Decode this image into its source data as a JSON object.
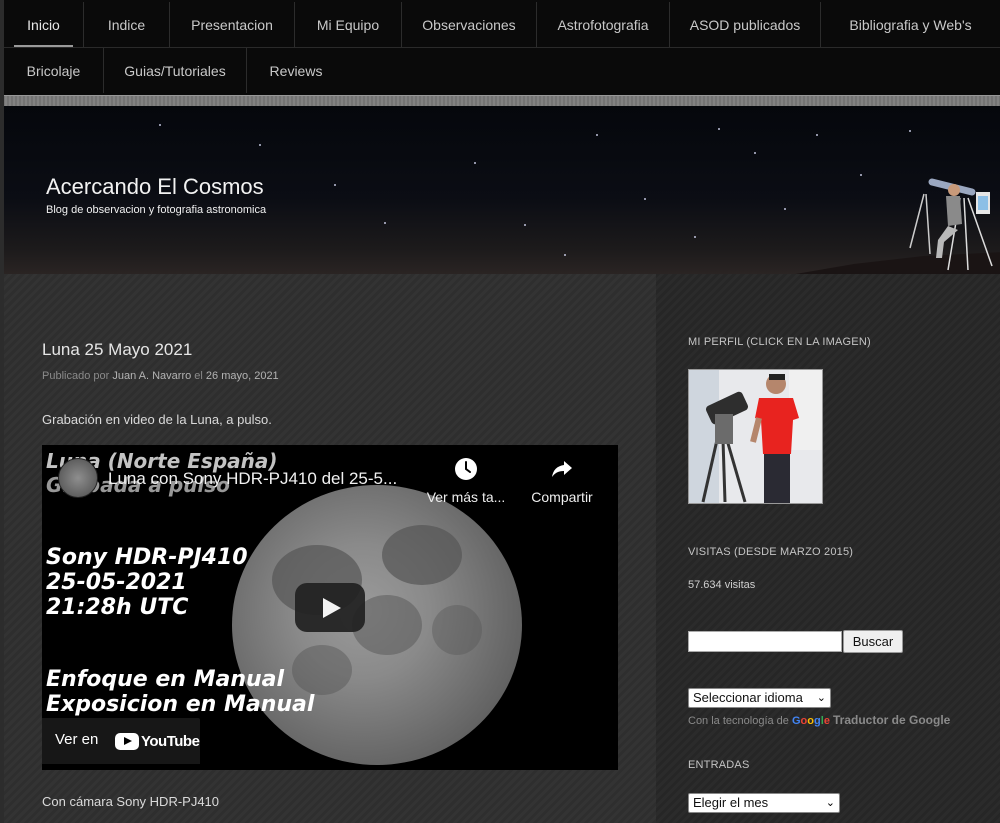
{
  "nav": {
    "row1": [
      "Inicio",
      "Indice",
      "Presentacion",
      "Mi Equipo",
      "Observaciones",
      "Astrofotografia",
      "ASOD publicados",
      "Bibliografia y Web's"
    ],
    "row2": [
      "Bricolaje",
      "Guias/Tutoriales",
      "Reviews"
    ]
  },
  "site": {
    "title": "Acercando El Cosmos",
    "description": "Blog de observacion y fotografia astronomica"
  },
  "post": {
    "title": "Luna 25 Mayo 2021",
    "meta_prefix": "Publicado por",
    "author": "Juan A. Navarro",
    "meta_mid": "el",
    "date": "26 mayo, 2021",
    "intro": "Grabación en video de la Luna, a pulso.",
    "footer_text": "Con cámara Sony HDR-PJ410"
  },
  "video": {
    "title": "Luna con Sony HDR-PJ410 del 25-5...",
    "caption_line1": "Luna (Norte España)",
    "caption_line2": "Grabada a pulso",
    "camera_line1": "Sony HDR-PJ410",
    "camera_line2": "25-05-2021",
    "camera_line3": "21:28h UTC",
    "mode_line1": "Enfoque en Manual",
    "mode_line2": "Exposicion en Manual",
    "watch_later": "Ver más ta...",
    "share": "Compartir",
    "watch_on": "Ver en",
    "youtube": "YouTube"
  },
  "sidebar": {
    "profile_title": "MI PERFIL (CLICK EN LA IMAGEN)",
    "visits_title": "VISITAS (DESDE MARZO 2015)",
    "visits_count": "57.634 visitas",
    "search_button": "Buscar",
    "language_select": "Seleccionar idioma",
    "powered_prefix": "Con la tecnología de",
    "powered_google": "Google",
    "powered_translate": "Traductor de Google",
    "entries_title": "ENTRADAS",
    "month_select": "Elegir el mes"
  },
  "colors": {
    "background": "#2c2c2c",
    "nav_bg": "#0a0a0a",
    "youtube_red": "#ff0000"
  }
}
